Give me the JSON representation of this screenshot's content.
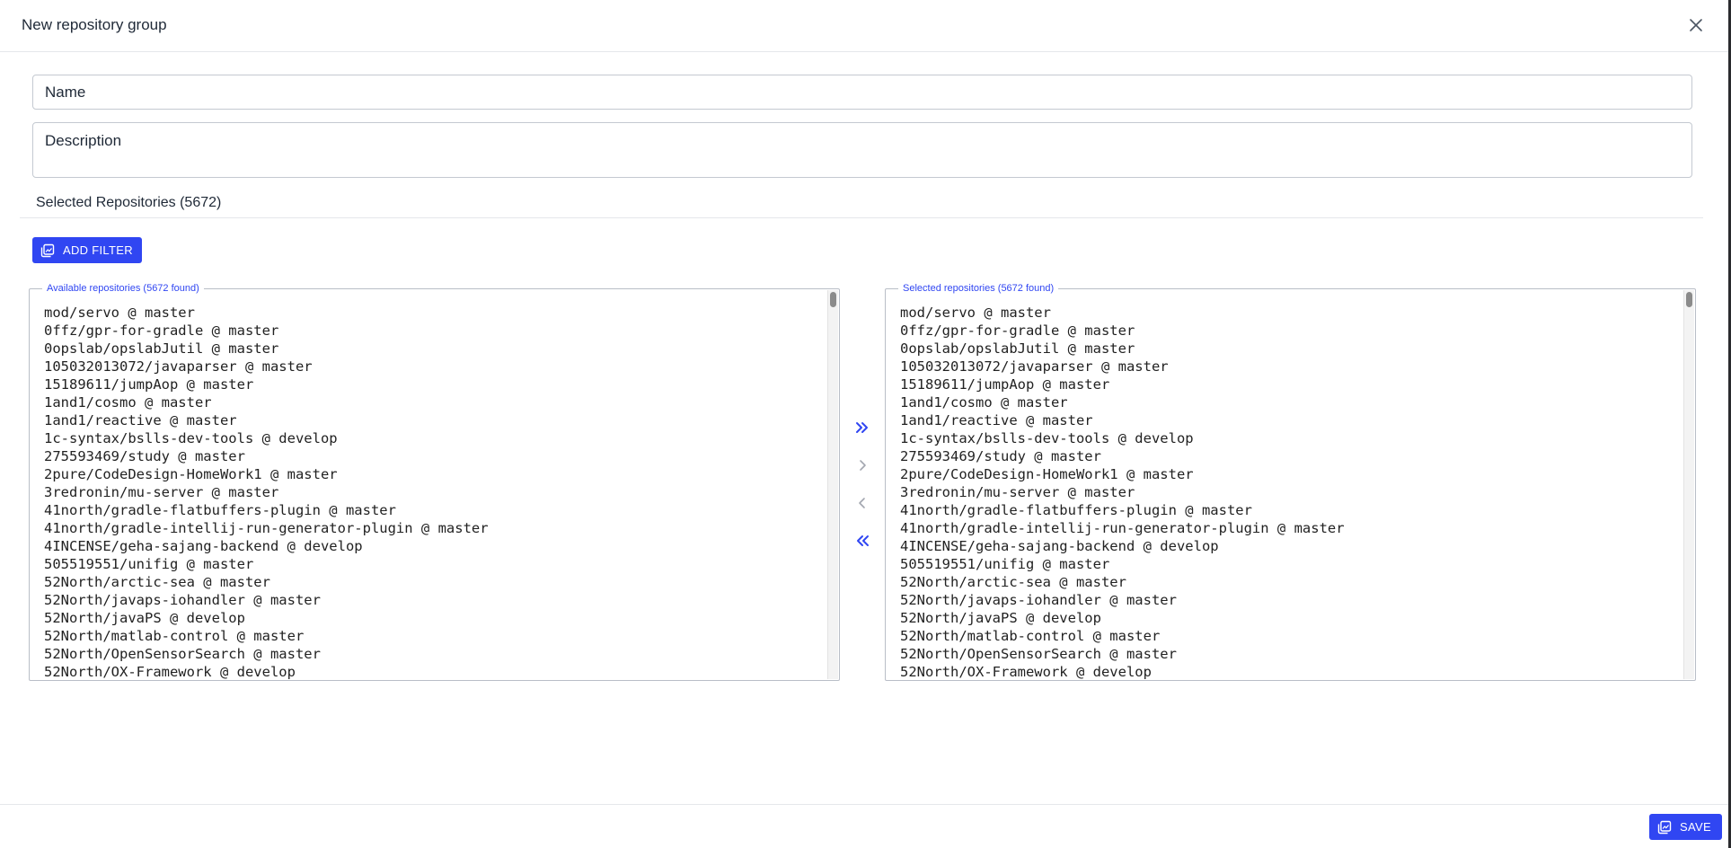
{
  "dialog": {
    "title": "New repository group",
    "close_icon": "close-icon"
  },
  "form": {
    "name_placeholder": "Name",
    "description_placeholder": "Description"
  },
  "selected_section": {
    "title": "Selected Repositories (5672)"
  },
  "add_filter": {
    "label": "ADD FILTER",
    "icon": "filter-stack-icon"
  },
  "available": {
    "legend": "Available repositories (5672 found)",
    "items": [
      "mod/servo @ master",
      "0ffz/gpr-for-gradle @ master",
      "0opslab/opslabJutil @ master",
      "105032013072/javaparser @ master",
      "15189611/jumpAop @ master",
      "1and1/cosmo @ master",
      "1and1/reactive @ master",
      "1c-syntax/bslls-dev-tools @ develop",
      "275593469/study @ master",
      "2pure/CodeDesign-HomeWork1 @ master",
      "3redronin/mu-server @ master",
      "41north/gradle-flatbuffers-plugin @ master",
      "41north/gradle-intellij-run-generator-plugin @ master",
      "4INCENSE/geha-sajang-backend @ develop",
      "505519551/unifig @ master",
      "52North/arctic-sea @ master",
      "52North/javaps-iohandler @ master",
      "52North/javaPS @ develop",
      "52North/matlab-control @ master",
      "52North/OpenSensorSearch @ master",
      "52North/OX-Framework @ develop"
    ]
  },
  "selected": {
    "legend": "Selected repositories (5672 found)",
    "items": [
      "mod/servo @ master",
      "0ffz/gpr-for-gradle @ master",
      "0opslab/opslabJutil @ master",
      "105032013072/javaparser @ master",
      "15189611/jumpAop @ master",
      "1and1/cosmo @ master",
      "1and1/reactive @ master",
      "1c-syntax/bslls-dev-tools @ develop",
      "275593469/study @ master",
      "2pure/CodeDesign-HomeWork1 @ master",
      "3redronin/mu-server @ master",
      "41north/gradle-flatbuffers-plugin @ master",
      "41north/gradle-intellij-run-generator-plugin @ master",
      "4INCENSE/geha-sajang-backend @ develop",
      "505519551/unifig @ master",
      "52North/arctic-sea @ master",
      "52North/javaps-iohandler @ master",
      "52North/javaPS @ develop",
      "52North/matlab-control @ master",
      "52North/OpenSensorSearch @ master",
      "52North/OX-Framework @ develop"
    ]
  },
  "transfer_buttons": {
    "move_all_right": "double-chevron-right-icon",
    "move_right": "chevron-right-icon",
    "move_left": "chevron-left-icon",
    "move_all_left": "double-chevron-left-icon"
  },
  "save": {
    "label": "SAVE",
    "icon": "filter-stack-icon"
  },
  "colors": {
    "accent": "#3046f2",
    "disabled_icon": "#a3a7b0",
    "border": "#c4c9d1"
  }
}
